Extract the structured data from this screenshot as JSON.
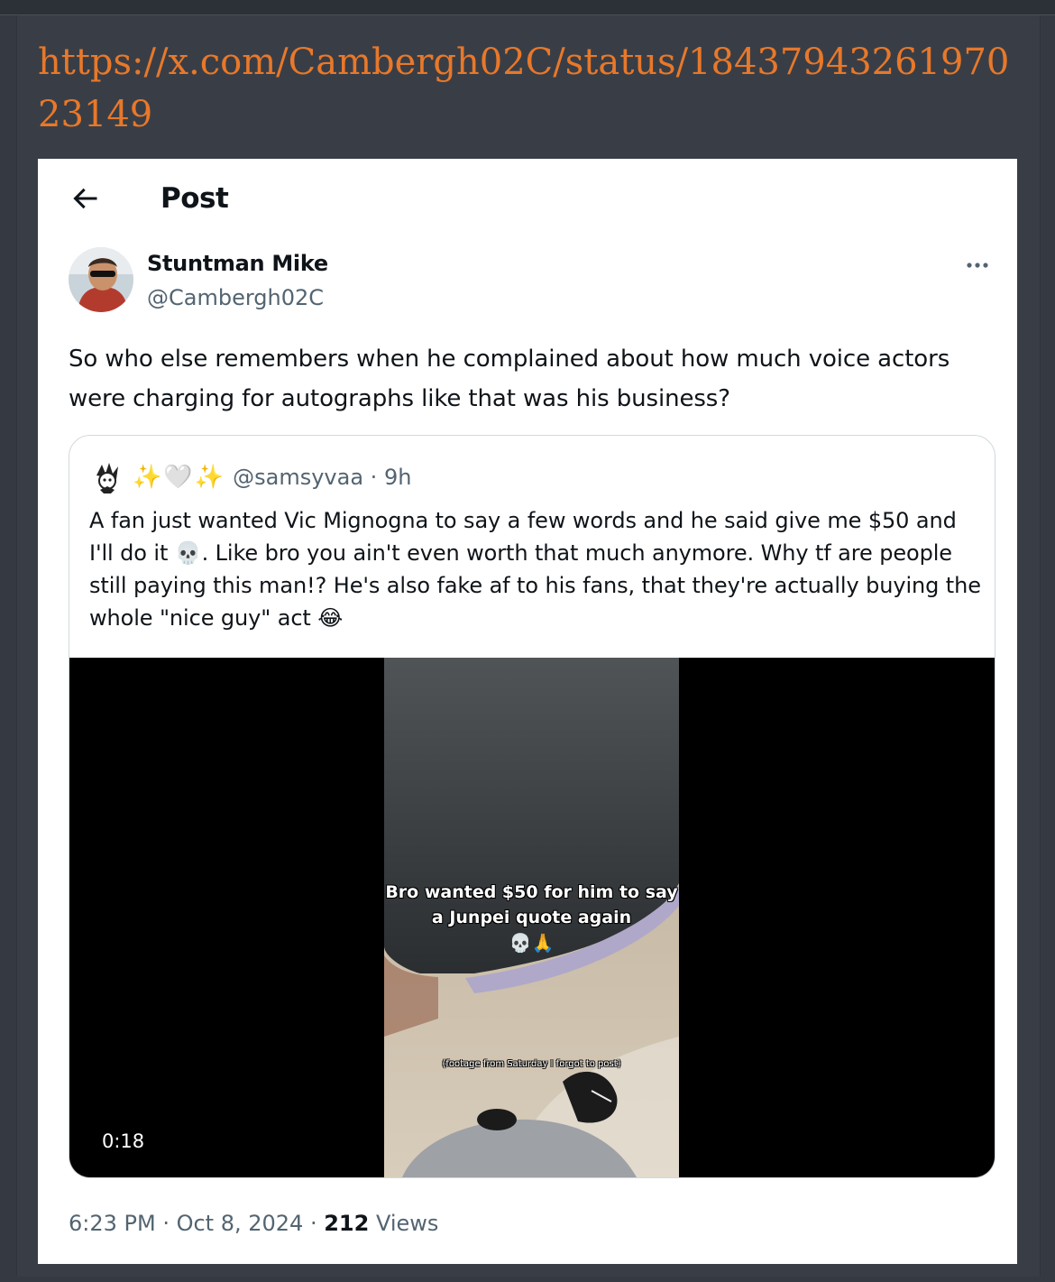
{
  "url": "https://x.com/Cambergh02C/status/1843794326197023149",
  "header": {
    "title": "Post",
    "back_icon": "arrow-left-icon"
  },
  "author": {
    "name": "Stuntman Mike",
    "handle": "@Cambergh02C",
    "more_icon": "more-horizontal-icon"
  },
  "tweet": {
    "text": "So who else remembers when he complained about how much voice actors were charging for autographs like that was his business?"
  },
  "quote": {
    "emojis": [
      "✨",
      "🤍",
      "✨"
    ],
    "handle": "@samsyvaa",
    "time": "9h",
    "text_part1": "A fan just wanted Vic Mignogna to say a few words and he said give me $50 and I'll do it ",
    "emoji1": "💀",
    "text_part2": ". Like bro you ain't even worth that much anymore. Why tf are people still paying this man!? He's also fake af to his fans, that they're actually buying the whole \"nice guy\" act ",
    "emoji2": "😂",
    "video": {
      "caption": "Bro wanted $50 for him to say a Junpei quote again",
      "caption_emoji": "💀🙏",
      "small_caption": "(footage from Saturday I forgot to post)",
      "duration": "0:18"
    }
  },
  "meta": {
    "time": "6:23 PM",
    "date": "Oct 8, 2024",
    "views_count": "212",
    "views_label": "Views"
  }
}
